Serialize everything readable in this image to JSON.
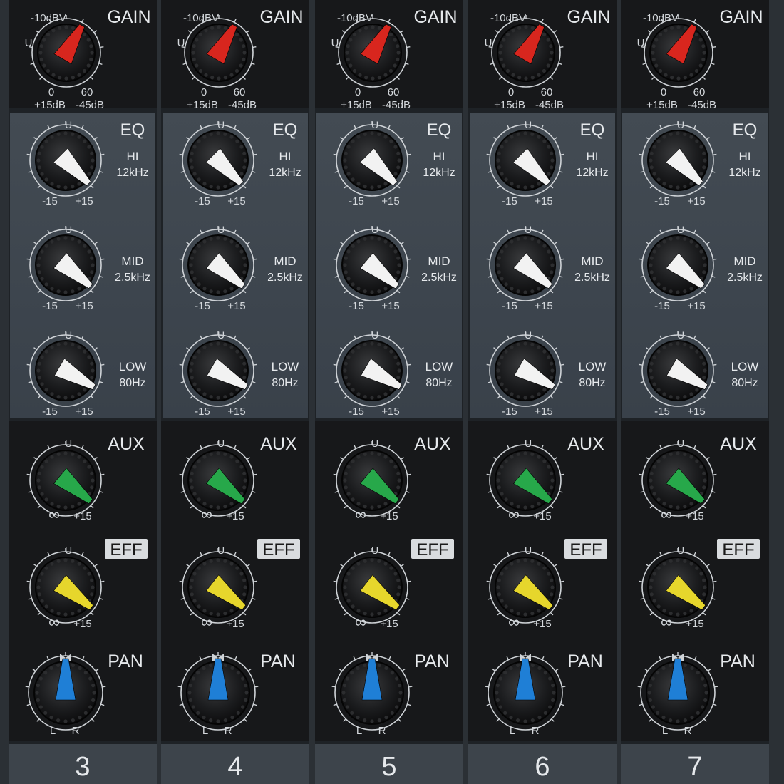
{
  "colors": {
    "gain_pointer": "#d8261e",
    "eq_pointer": "#f2f2f2",
    "aux_pointer": "#27a84a",
    "eff_pointer": "#e6d62c",
    "pan_pointer": "#1f7fd6",
    "panel_dark": "#17181a",
    "panel_grey": "#3b434a"
  },
  "labels": {
    "gain": "GAIN",
    "gain_top": "-10dBV",
    "gain_unity": "U",
    "gain_min": "0",
    "gain_max": "60",
    "gain_db_min": "+15dB",
    "gain_db_max": "-45dB",
    "eq": "EQ",
    "hi": "HI",
    "hi_freq": "12kHz",
    "mid": "MID",
    "mid_freq": "2.5kHz",
    "low": "LOW",
    "low_freq": "80Hz",
    "unity": "U",
    "minus15": "-15",
    "plus15": "+15",
    "aux": "AUX",
    "eff": "EFF",
    "infinity": "∞",
    "pan": "PAN",
    "left": "L",
    "right": "R"
  },
  "channels": [
    {
      "number": "3"
    },
    {
      "number": "4"
    },
    {
      "number": "5"
    },
    {
      "number": "6"
    },
    {
      "number": "7"
    }
  ]
}
